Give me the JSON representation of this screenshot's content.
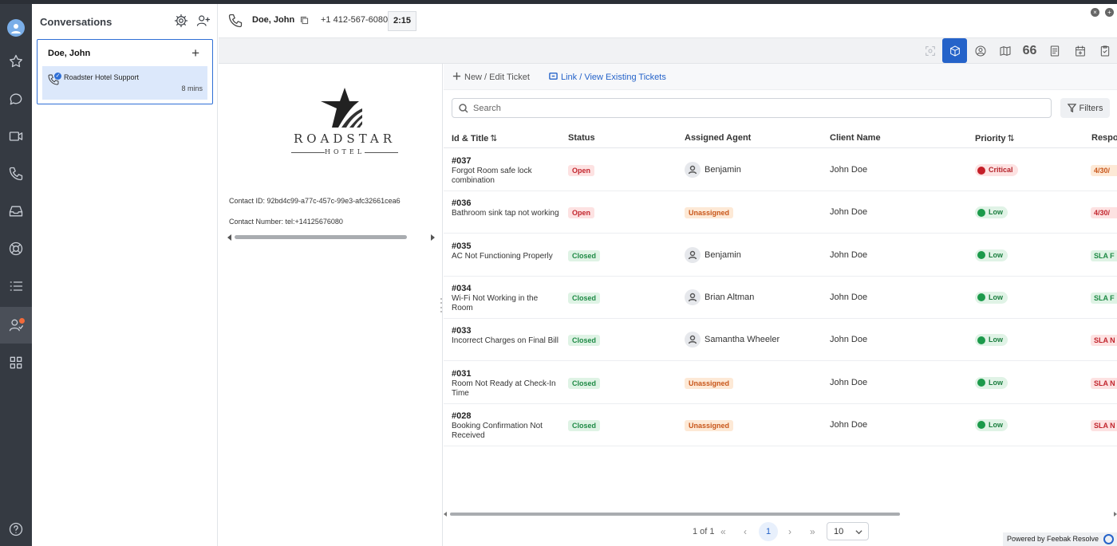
{
  "rail": {
    "items": [
      "profile-avatar",
      "star-icon",
      "chat-icon",
      "video-icon",
      "phone-icon",
      "inbox-icon",
      "lifebuoy-icon",
      "list-icon",
      "contacts-icon",
      "apps-icon",
      "help-icon"
    ]
  },
  "conversations": {
    "title": "Conversations",
    "card": {
      "name": "Doe, John",
      "add": "+",
      "item_label": "Roadster Hotel Support",
      "item_time": "8 mins"
    }
  },
  "call": {
    "name": "Doe, John",
    "number": "+1 412-567-6080",
    "timer": "2:15",
    "quote_icon_text": "66"
  },
  "contact": {
    "logo_word": "ROADSTAR",
    "logo_sub": "HOTEL",
    "id_line": "Contact ID: 92bd4c99-a77c-457c-99e3-afc32661cea6",
    "number_line": "Contact Number: tel:+14125676080"
  },
  "tickets": {
    "new_edit": "New / Edit Ticket",
    "link_view": "Link / View Existing Tickets",
    "search_placeholder": "Search",
    "filters": "Filters",
    "columns": {
      "id_title": "Id & Title",
      "status": "Status",
      "agent": "Assigned Agent",
      "client": "Client Name",
      "priority": "Priority",
      "response": "Respo"
    },
    "rows": [
      {
        "id": "#037",
        "title": "Forgot Room safe lock combination",
        "status": "Open",
        "agent": "Benjamin",
        "client": "John Doe",
        "priority": "Critical",
        "response": "4/30/"
      },
      {
        "id": "#036",
        "title": "Bathroom sink tap not working",
        "status": "Open",
        "agent": "Unassigned",
        "client": "John Doe",
        "priority": "Low",
        "response": "4/30/"
      },
      {
        "id": "#035",
        "title": "AC Not Functioning Properly",
        "status": "Closed",
        "agent": "Benjamin",
        "client": "John Doe",
        "priority": "Low",
        "response": "SLA F"
      },
      {
        "id": "#034",
        "title": "Wi-Fi Not Working in the Room",
        "status": "Closed",
        "agent": "Brian Altman",
        "client": "John Doe",
        "priority": "Low",
        "response": "SLA F"
      },
      {
        "id": "#033",
        "title": "Incorrect Charges on Final Bill",
        "status": "Closed",
        "agent": "Samantha Wheeler",
        "client": "John Doe",
        "priority": "Low",
        "response": "SLA N"
      },
      {
        "id": "#031",
        "title": "Room Not Ready at Check-In Time",
        "status": "Closed",
        "agent": "Unassigned",
        "client": "John Doe",
        "priority": "Low",
        "response": "SLA N"
      },
      {
        "id": "#028",
        "title": "Booking Confirmation Not Received",
        "status": "Closed",
        "agent": "Unassigned",
        "client": "John Doe",
        "priority": "Low",
        "response": "SLA N"
      }
    ],
    "pager": {
      "info": "1 of 1",
      "current": "1",
      "page_size": "10"
    },
    "powered_by": "Powered by Feebak Resolve"
  },
  "colors": {
    "accent": "#2563c9",
    "rail": "#353a42",
    "open": "#c2262e",
    "closed": "#1e8a45",
    "unassigned": "#c8561a"
  }
}
